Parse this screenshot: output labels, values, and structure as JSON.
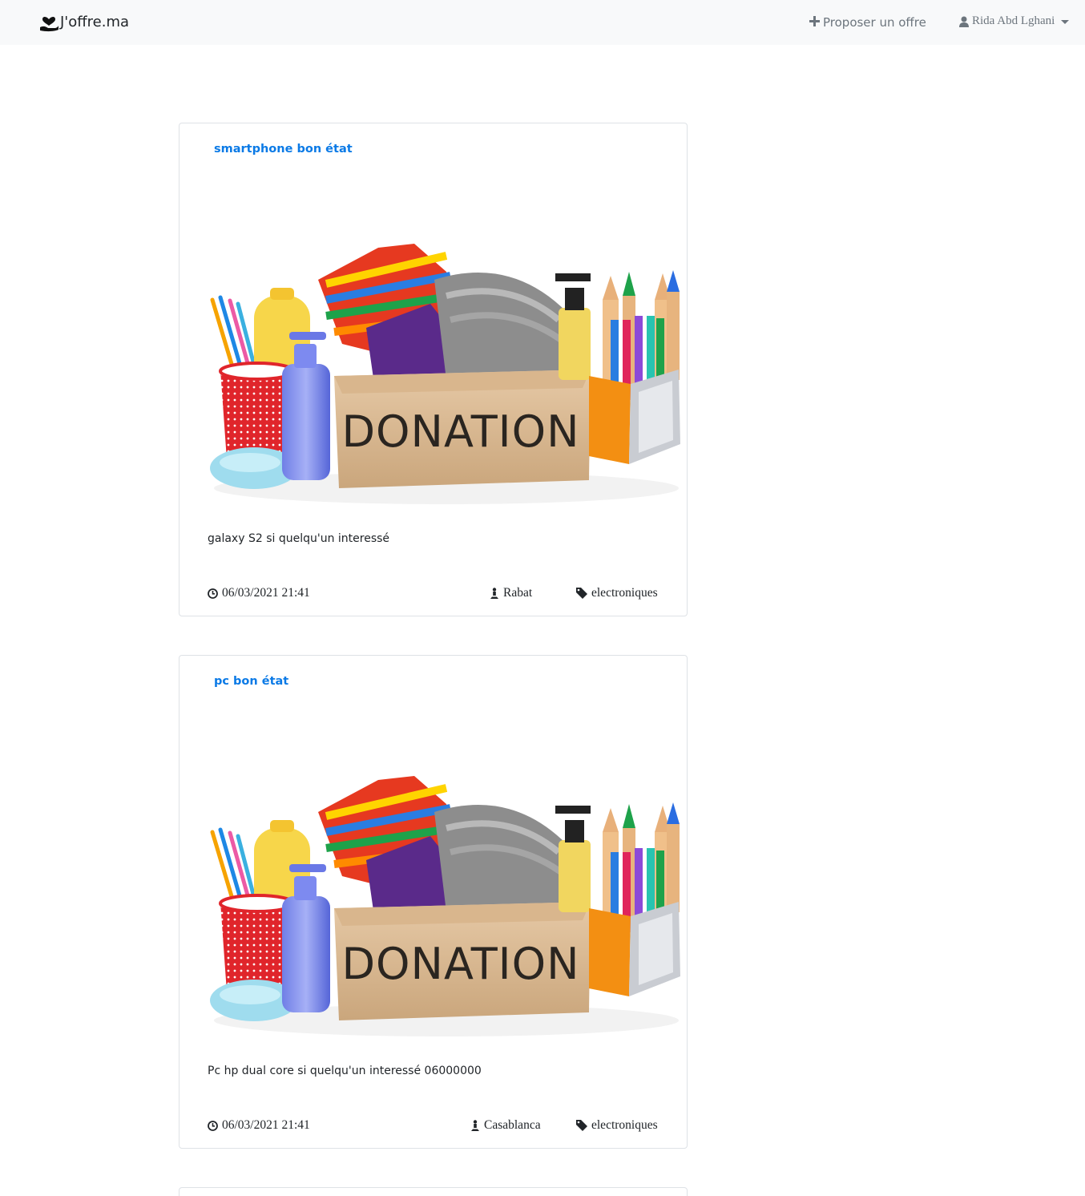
{
  "navbar": {
    "brand_icon": "hand-heart-icon",
    "brand": "J'offre.ma",
    "propose_icon": "plus-icon",
    "propose_label": "Proposer un offre",
    "user_icon": "user-icon",
    "user_name": "Rida Abd Lghani",
    "user_caret": "chevron-down-icon"
  },
  "offers": [
    {
      "title": "smartphone bon état",
      "image_label": "DONATION",
      "description": "galaxy S2 si quelqu'un interessé",
      "date": "06/03/2021 21:41",
      "city": "Rabat",
      "category": "electroniques"
    },
    {
      "title": "pc bon état",
      "image_label": "DONATION",
      "description": "Pc hp dual core si quelqu'un interessé 06000000",
      "date": "06/03/2021 21:41",
      "city": "Casablanca",
      "category": "electroniques"
    }
  ],
  "colors": {
    "accent": "#0b7ae6",
    "navbar_bg": "#f8f9fa",
    "muted": "#6c757d"
  }
}
